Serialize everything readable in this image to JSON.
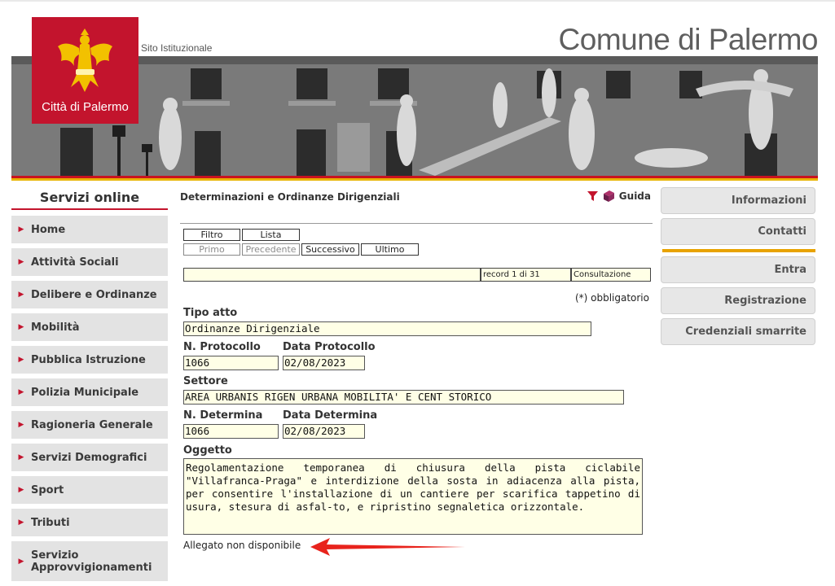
{
  "header": {
    "logo_text": "Città di Palermo",
    "site_label": "Sito Istituzionale",
    "site_title": "Comune di Palermo"
  },
  "sidebar": {
    "title": "Servizi online",
    "items": [
      {
        "label": "Home"
      },
      {
        "label": "Attività Sociali"
      },
      {
        "label": "Delibere e Ordinanze"
      },
      {
        "label": "Mobilità"
      },
      {
        "label": "Pubblica Istruzione"
      },
      {
        "label": "Polizia Municipale"
      },
      {
        "label": "Ragioneria Generale"
      },
      {
        "label": "Servizi Demografici"
      },
      {
        "label": "Sport"
      },
      {
        "label": "Tributi"
      },
      {
        "label": "Servizio Approvvigionamenti"
      }
    ]
  },
  "main": {
    "page_title": "Determinazioni e Ordinanze Dirigenziali",
    "guida_label": "Guida",
    "toolbar": {
      "filtro": "Filtro",
      "lista": "Lista",
      "primo": "Primo",
      "precedente": "Precedente",
      "successivo": "Successivo",
      "ultimo": "Ultimo"
    },
    "status": {
      "message": "",
      "record": "record 1 di 31",
      "mode": "Consultazione"
    },
    "required_note": "(*) obbligatorio",
    "fields": {
      "tipo_atto_label": "Tipo atto",
      "tipo_atto": "Ordinanze Dirigenziale",
      "n_protocollo_label": "N. Protocollo",
      "n_protocollo": "1066",
      "data_protocollo_label": "Data Protocollo",
      "data_protocollo": "02/08/2023",
      "settore_label": "Settore",
      "settore": "AREA URBANIS RIGEN URBANA MOBILITA' E CENT STORICO",
      "n_determina_label": "N. Determina",
      "n_determina": "1066",
      "data_determina_label": "Data Determina",
      "data_determina": "02/08/2023",
      "oggetto_label": "Oggetto",
      "oggetto": "Regolamentazione temporanea di chiusura della pista ciclabile \"Villafranca-Praga\" e interdizione della sosta in adiacenza alla pista, per consentire l'installazione di un cantiere per scarifica tappetino di usura, stesura di asfal-to, e ripristino segnaletica orizzontale."
    },
    "attachment_note": "Allegato non disponibile"
  },
  "right_menu": {
    "informazioni": "Informazioni",
    "contatti": "Contatti",
    "entra": "Entra",
    "registrazione": "Registrazione",
    "credenziali": "Credenziali smarrite"
  },
  "colors": {
    "brand_red": "#c3142d",
    "accent_yellow": "#e8a300",
    "field_bg": "#ffffe6",
    "annotation_arrow": "#e8231c"
  },
  "icons": [
    "filter-icon",
    "guide-book-icon",
    "eagle-crest-icon",
    "arrow-annotation"
  ]
}
